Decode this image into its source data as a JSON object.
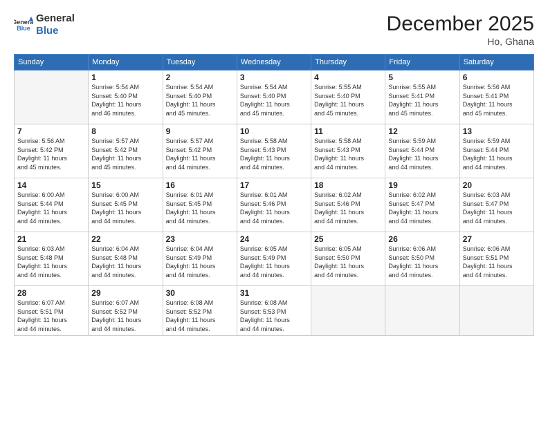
{
  "logo": {
    "general": "General",
    "blue": "Blue"
  },
  "title": "December 2025",
  "subtitle": "Ho, Ghana",
  "weekdays": [
    "Sunday",
    "Monday",
    "Tuesday",
    "Wednesday",
    "Thursday",
    "Friday",
    "Saturday"
  ],
  "weeks": [
    [
      {
        "day": "",
        "info": ""
      },
      {
        "day": "1",
        "info": "Sunrise: 5:54 AM\nSunset: 5:40 PM\nDaylight: 11 hours\nand 46 minutes."
      },
      {
        "day": "2",
        "info": "Sunrise: 5:54 AM\nSunset: 5:40 PM\nDaylight: 11 hours\nand 45 minutes."
      },
      {
        "day": "3",
        "info": "Sunrise: 5:54 AM\nSunset: 5:40 PM\nDaylight: 11 hours\nand 45 minutes."
      },
      {
        "day": "4",
        "info": "Sunrise: 5:55 AM\nSunset: 5:40 PM\nDaylight: 11 hours\nand 45 minutes."
      },
      {
        "day": "5",
        "info": "Sunrise: 5:55 AM\nSunset: 5:41 PM\nDaylight: 11 hours\nand 45 minutes."
      },
      {
        "day": "6",
        "info": "Sunrise: 5:56 AM\nSunset: 5:41 PM\nDaylight: 11 hours\nand 45 minutes."
      }
    ],
    [
      {
        "day": "7",
        "info": "Sunrise: 5:56 AM\nSunset: 5:42 PM\nDaylight: 11 hours\nand 45 minutes."
      },
      {
        "day": "8",
        "info": "Sunrise: 5:57 AM\nSunset: 5:42 PM\nDaylight: 11 hours\nand 45 minutes."
      },
      {
        "day": "9",
        "info": "Sunrise: 5:57 AM\nSunset: 5:42 PM\nDaylight: 11 hours\nand 44 minutes."
      },
      {
        "day": "10",
        "info": "Sunrise: 5:58 AM\nSunset: 5:43 PM\nDaylight: 11 hours\nand 44 minutes."
      },
      {
        "day": "11",
        "info": "Sunrise: 5:58 AM\nSunset: 5:43 PM\nDaylight: 11 hours\nand 44 minutes."
      },
      {
        "day": "12",
        "info": "Sunrise: 5:59 AM\nSunset: 5:44 PM\nDaylight: 11 hours\nand 44 minutes."
      },
      {
        "day": "13",
        "info": "Sunrise: 5:59 AM\nSunset: 5:44 PM\nDaylight: 11 hours\nand 44 minutes."
      }
    ],
    [
      {
        "day": "14",
        "info": "Sunrise: 6:00 AM\nSunset: 5:44 PM\nDaylight: 11 hours\nand 44 minutes."
      },
      {
        "day": "15",
        "info": "Sunrise: 6:00 AM\nSunset: 5:45 PM\nDaylight: 11 hours\nand 44 minutes."
      },
      {
        "day": "16",
        "info": "Sunrise: 6:01 AM\nSunset: 5:45 PM\nDaylight: 11 hours\nand 44 minutes."
      },
      {
        "day": "17",
        "info": "Sunrise: 6:01 AM\nSunset: 5:46 PM\nDaylight: 11 hours\nand 44 minutes."
      },
      {
        "day": "18",
        "info": "Sunrise: 6:02 AM\nSunset: 5:46 PM\nDaylight: 11 hours\nand 44 minutes."
      },
      {
        "day": "19",
        "info": "Sunrise: 6:02 AM\nSunset: 5:47 PM\nDaylight: 11 hours\nand 44 minutes."
      },
      {
        "day": "20",
        "info": "Sunrise: 6:03 AM\nSunset: 5:47 PM\nDaylight: 11 hours\nand 44 minutes."
      }
    ],
    [
      {
        "day": "21",
        "info": "Sunrise: 6:03 AM\nSunset: 5:48 PM\nDaylight: 11 hours\nand 44 minutes."
      },
      {
        "day": "22",
        "info": "Sunrise: 6:04 AM\nSunset: 5:48 PM\nDaylight: 11 hours\nand 44 minutes."
      },
      {
        "day": "23",
        "info": "Sunrise: 6:04 AM\nSunset: 5:49 PM\nDaylight: 11 hours\nand 44 minutes."
      },
      {
        "day": "24",
        "info": "Sunrise: 6:05 AM\nSunset: 5:49 PM\nDaylight: 11 hours\nand 44 minutes."
      },
      {
        "day": "25",
        "info": "Sunrise: 6:05 AM\nSunset: 5:50 PM\nDaylight: 11 hours\nand 44 minutes."
      },
      {
        "day": "26",
        "info": "Sunrise: 6:06 AM\nSunset: 5:50 PM\nDaylight: 11 hours\nand 44 minutes."
      },
      {
        "day": "27",
        "info": "Sunrise: 6:06 AM\nSunset: 5:51 PM\nDaylight: 11 hours\nand 44 minutes."
      }
    ],
    [
      {
        "day": "28",
        "info": "Sunrise: 6:07 AM\nSunset: 5:51 PM\nDaylight: 11 hours\nand 44 minutes."
      },
      {
        "day": "29",
        "info": "Sunrise: 6:07 AM\nSunset: 5:52 PM\nDaylight: 11 hours\nand 44 minutes."
      },
      {
        "day": "30",
        "info": "Sunrise: 6:08 AM\nSunset: 5:52 PM\nDaylight: 11 hours\nand 44 minutes."
      },
      {
        "day": "31",
        "info": "Sunrise: 6:08 AM\nSunset: 5:53 PM\nDaylight: 11 hours\nand 44 minutes."
      },
      {
        "day": "",
        "info": ""
      },
      {
        "day": "",
        "info": ""
      },
      {
        "day": "",
        "info": ""
      }
    ]
  ]
}
